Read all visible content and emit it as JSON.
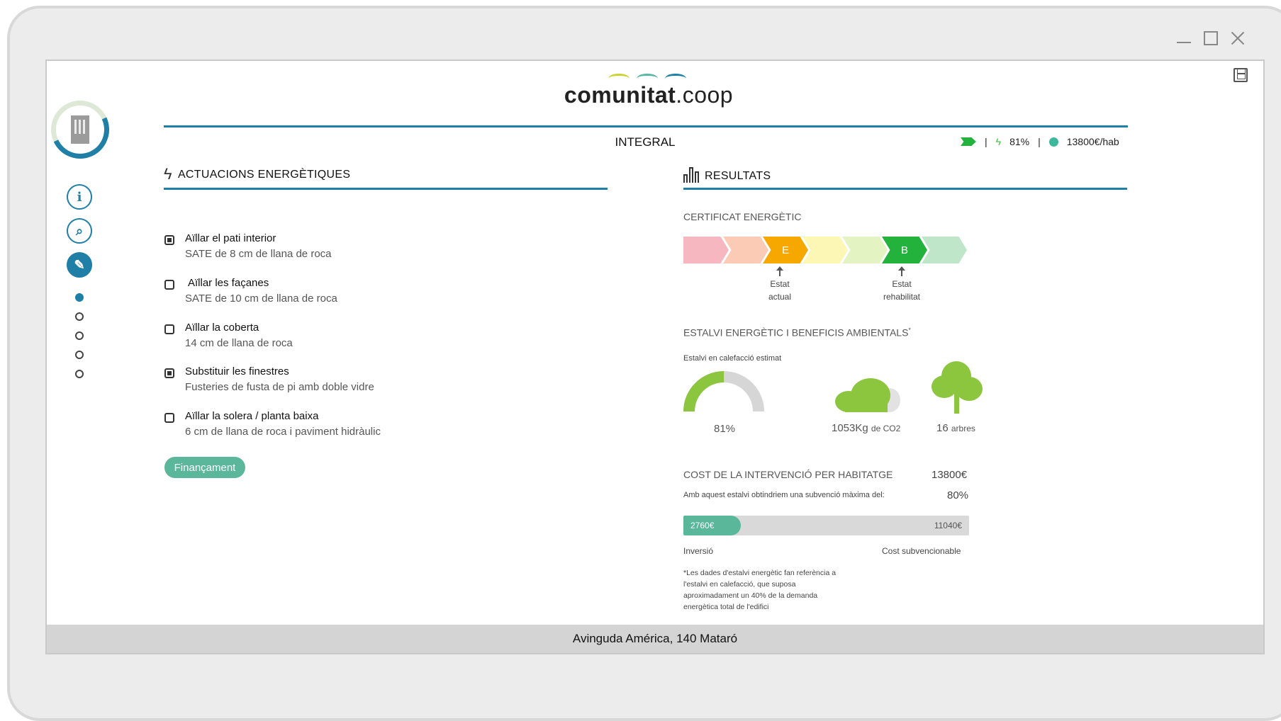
{
  "brand": {
    "name_bold": "comunitat",
    "name_light": ".coop",
    "arc_colors": [
      "#c9d32b",
      "#58b6a3",
      "#1f7fa6"
    ]
  },
  "header": {
    "mode": "INTEGRAL",
    "saving_pct": "81%",
    "cost_per_home": "13800€/hab",
    "class_color": "#23b23c"
  },
  "sidebar": {
    "nav": [
      {
        "name": "info-icon",
        "glyph": "i"
      },
      {
        "name": "search-icon",
        "glyph": "⌕"
      },
      {
        "name": "brush-icon",
        "glyph": "✎"
      }
    ],
    "steps": 5,
    "current_step": 1
  },
  "actuacions": {
    "heading": "ACTUACIONS ENERGÈTIQUES",
    "items": [
      {
        "title": "Aïllar el pati interior",
        "sub": "SATE de 8 cm de llana de roca",
        "checked": true
      },
      {
        "title": "Aïllar les façanes",
        "sub": "SATE de 10 cm de llana de roca",
        "checked": false
      },
      {
        "title": "Aïllar la coberta",
        "sub": "14 cm de llana de roca",
        "checked": false
      },
      {
        "title": "Substituir les finestres",
        "sub": "Fusteries de fusta de pi amb doble vidre",
        "checked": true
      },
      {
        "title": "Aïllar la solera / planta baixa",
        "sub": "6 cm de llana de roca i paviment hidràulic",
        "checked": false
      }
    ],
    "button": "Finançament"
  },
  "resultats": {
    "heading": "RESULTATS",
    "cert_title": "CERTIFICAT ENERGÈTIC",
    "cert_scale": [
      {
        "color": "#f7b7c0",
        "label": ""
      },
      {
        "color": "#fbcbb5",
        "label": ""
      },
      {
        "color": "#f7a800",
        "label": "E"
      },
      {
        "color": "#fdf7b5",
        "label": ""
      },
      {
        "color": "#e3f3c2",
        "label": ""
      },
      {
        "color": "#23b23c",
        "label": "B"
      },
      {
        "color": "#bfe6c8",
        "label": ""
      }
    ],
    "cert_current": {
      "line1": "Estat",
      "line2": "actual"
    },
    "cert_rehab": {
      "line1": "Estat",
      "line2": "rehabilitat"
    },
    "env_title": "ESTALVI ENERGÈTIC I BENEFICIS AMBIENTALS",
    "env_mark": "*",
    "heating_label": "Estalvi en calefacció estimat",
    "heating_value": "81%",
    "heating_fraction": 0.81,
    "co2_value": "1053Kg",
    "co2_unit": "de CO2",
    "trees_value": "16",
    "trees_unit": "arbres",
    "cost_title": "COST DE LA INTERVENCIÓ PER HABITATGE",
    "cost_value": "13800€",
    "subsidy_text": "Amb aquest estalvi obtindriem una subvenció màxima del:",
    "subsidy_value": "80%",
    "investment": "2760€",
    "subsidizable": "11040€",
    "investment_fraction": 0.2,
    "investment_label": "Inversió",
    "subsidizable_label": "Cost subvencionable",
    "footnote": "*Les dades d'estalvi energètic fan referència a l'estalvi en calefacció, que suposa aproximadament un 40% de la demanda energètica total de l'edifici"
  },
  "footer": {
    "address": "Avinguda América, 140 Mataró"
  }
}
